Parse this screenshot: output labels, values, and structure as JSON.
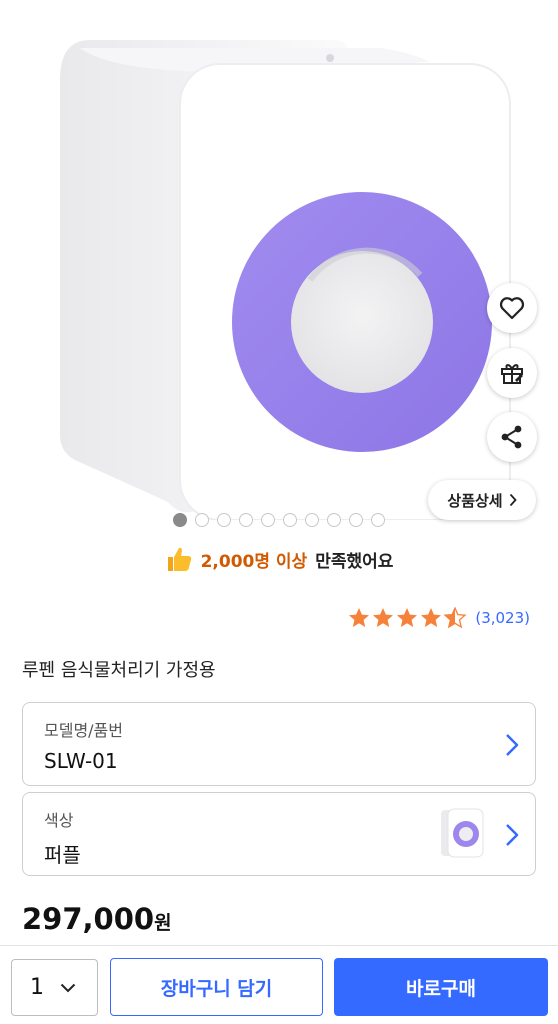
{
  "gallery": {
    "total_images": 10,
    "active_index": 0,
    "device_ring_color": "#9d86ec",
    "detail_button_label": "상품상세"
  },
  "actions": {
    "wishlist_icon": "heart-icon",
    "gift_icon": "gift-icon",
    "share_icon": "share-icon"
  },
  "satisfaction": {
    "highlight": "2,000명 이상",
    "rest": "만족했어요"
  },
  "rating": {
    "stars": 4.5,
    "count_text": "(3,023)"
  },
  "product": {
    "title": "루펜 음식물처리기 가정용"
  },
  "options": {
    "model": {
      "label": "모델명/품번",
      "value": "SLW-01"
    },
    "color": {
      "label": "색상",
      "value": "퍼플"
    }
  },
  "price": {
    "amount": "297,000",
    "unit": "원"
  },
  "purchase_bar": {
    "quantity": "1",
    "cart_label": "장바구니 담기",
    "buy_label": "바로구매"
  },
  "colors": {
    "accent": "#346aff",
    "highlight_orange": "#d15a00",
    "star": "#f5813a"
  }
}
